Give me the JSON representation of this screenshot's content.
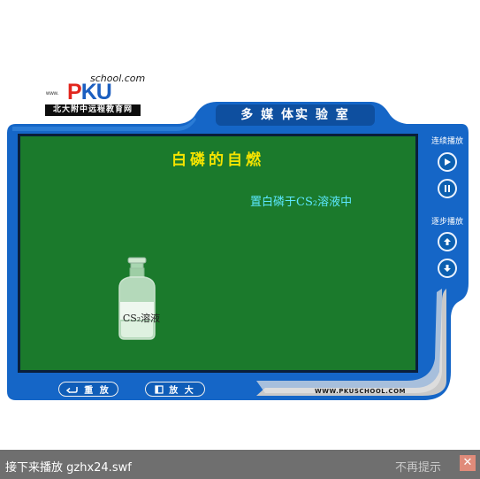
{
  "logo": {
    "school_text": "school.com",
    "pku_text": "PKU",
    "www_text": "www.",
    "bar_text": "北大附中远程教育网"
  },
  "header": {
    "title": "多 媒 体实 验 室"
  },
  "board": {
    "title": "白磷的自燃",
    "subtitle": "置白磷于CS₂溶液中",
    "bottle_label": "CS₂溶液"
  },
  "controls": {
    "continuous_label": "连续播放",
    "step_label": "逐步播放"
  },
  "buttons": {
    "replay_label": "重 放",
    "zoom_label": "放 大"
  },
  "footer": {
    "site_url": "WWW.PKUSCHOOL.COM"
  },
  "statusbar": {
    "next_label": "接下来播放 gzhx24.swf",
    "dismiss_label": "不再提示",
    "close_label": "✕"
  },
  "colors": {
    "frame_blue": "#1566c7",
    "board_green": "#1b7a2c",
    "title_yellow": "#f5e400",
    "subtitle_cyan": "#5ce8ff"
  },
  "icons": [
    "play-icon",
    "pause-icon",
    "step-up-icon",
    "step-down-icon",
    "replay-icon",
    "zoom-icon",
    "close-icon"
  ]
}
